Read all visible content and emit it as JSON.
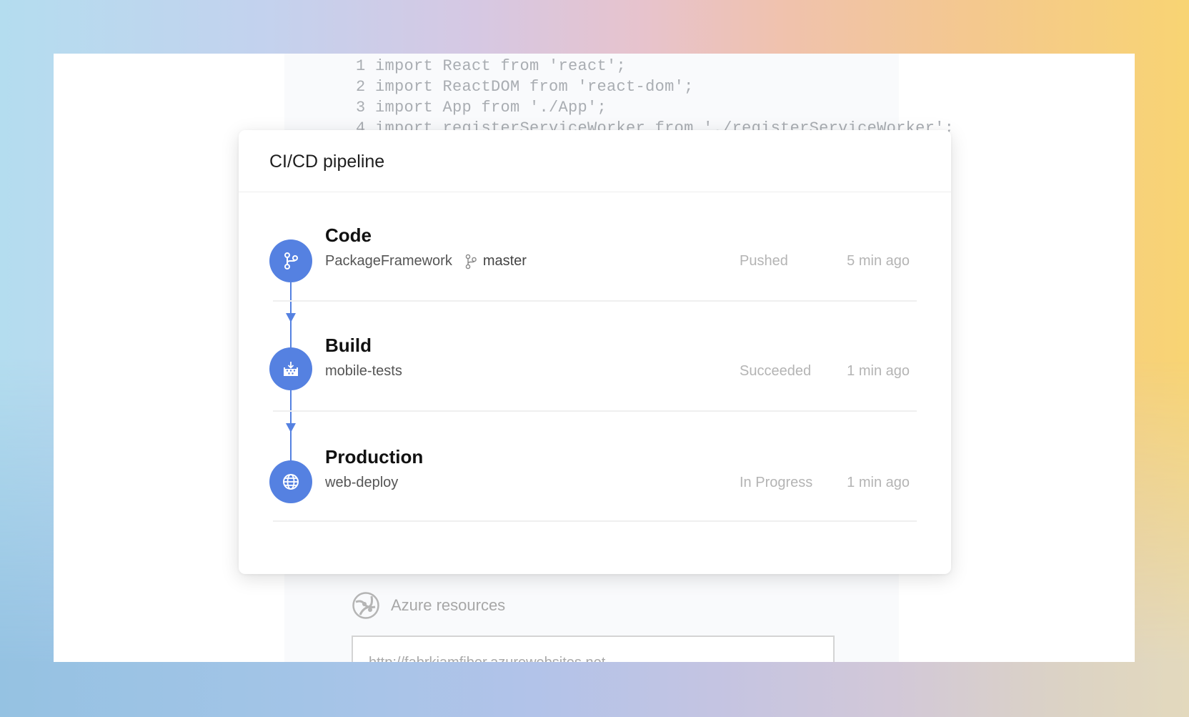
{
  "background": {
    "gradient_top": [
      "#b4ddef",
      "#c3d2ee",
      "#d6c8e3",
      "#e7c3cd",
      "#f0c2ad",
      "#f4c88e",
      "#f8d473"
    ],
    "gradient_bottom": [
      "#95c2e2",
      "#b2c3e9",
      "#d2c8d8",
      "#e3d9bd"
    ]
  },
  "editor": {
    "code_lines": [
      "1 import React from 'react';",
      "2 import ReactDOM from 'react-dom';",
      "3 import App from './App';",
      "4 import registerServiceWorker from './registerServiceWorker';"
    ],
    "azure": {
      "icon": "azure-resources-icon",
      "label": "Azure resources",
      "url_value": "http://fabrkiamfiber.azurewebsites.net"
    }
  },
  "pipeline": {
    "title": "CI/CD pipeline",
    "accent_color": "#5581e1",
    "stages": [
      {
        "name": "Code",
        "icon": "git-branch-icon",
        "subtitle": "PackageFramework",
        "branch_icon": "git-branch-icon",
        "branch": "master",
        "status": "Pushed",
        "time": "5 min ago"
      },
      {
        "name": "Build",
        "icon": "build-icon",
        "subtitle": "mobile-tests",
        "status": "Succeeded",
        "time": "1 min ago"
      },
      {
        "name": "Production",
        "icon": "globe-icon",
        "subtitle": "web-deploy",
        "status": "In Progress",
        "time": "1 min ago"
      }
    ]
  }
}
